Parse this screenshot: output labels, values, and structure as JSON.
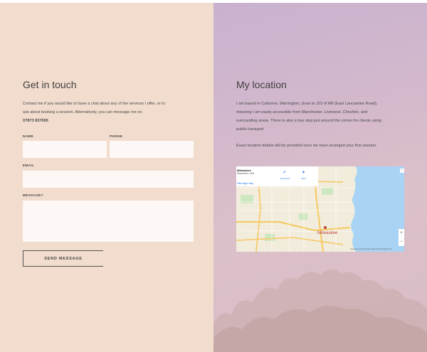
{
  "contact": {
    "title": "Get in touch",
    "intro_line1": "Contact me if you would like to have a chat about any of the services I offer, or to",
    "intro_line2": "ask about booking a session. Alternatively, you can message me on",
    "phone": "07873 837695",
    "name_label": "NAME",
    "phone_label": "PHONE",
    "email_label": "EMAIL",
    "message_label": "MESSAGE?",
    "name_value": "",
    "phone_value": "",
    "email_value": "",
    "message_value": "",
    "send_label": "SEND MESSAGE"
  },
  "location": {
    "title": "My location",
    "line1": "I am based in Culborne, Warrington, close to J23 of M6 (East Lancashire Road),",
    "line2": "meaning I am easily accessible from Manchester, Liverpool, Cheshire, and",
    "line3": "surrounding areas. There is also a bus stop just around the corner for clients using",
    "line4": "public transport.",
    "line5": "Exact location details will be provided once we have arranged your first session."
  },
  "map": {
    "place_title": "Milwaukee",
    "place_sub": "Wisconsin, USA",
    "view_link": "View larger map",
    "directions_label": "Directions",
    "streetview_label": "Save",
    "city_label": "Milwaukee",
    "zoom_in": "+",
    "zoom_out": "−",
    "attribution": "Keyboard shortcuts  Map data ©2023 Google  Terms",
    "fullscreen": "⛶",
    "colors": {
      "water": "#a9d3f4",
      "land": "#f2ecdc",
      "roads": "#f6c85f",
      "city": "#b8443b"
    }
  }
}
